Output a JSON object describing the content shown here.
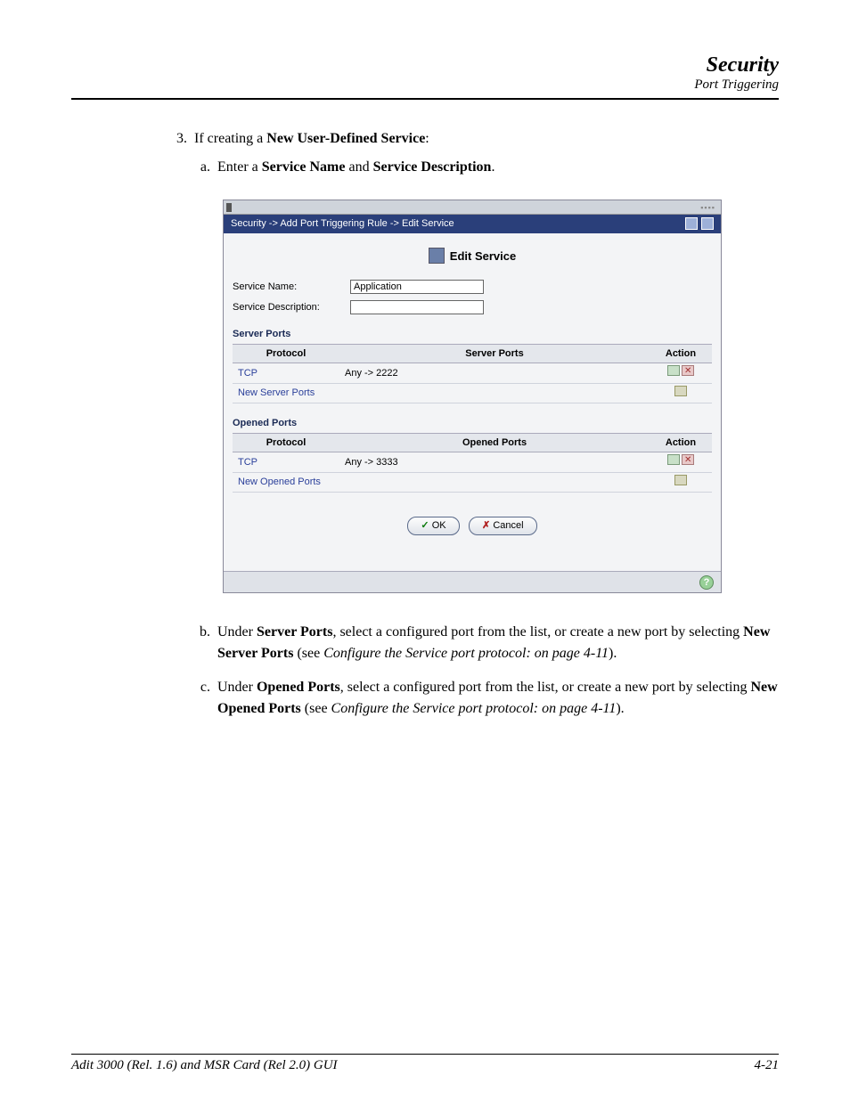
{
  "header": {
    "title": "Security",
    "subtitle": "Port Triggering"
  },
  "step3": {
    "num": "3.",
    "pre": "If creating a ",
    "bold": "New User-Defined Service",
    "post": ":"
  },
  "stepA": {
    "let": "a.",
    "pre": "Enter a ",
    "b1": "Service Name",
    "mid": " and ",
    "b2": "Service Description",
    "post": "."
  },
  "screenshot": {
    "breadcrumb": "Security -> Add Port Triggering Rule -> Edit Service",
    "panelTitle": "Edit Service",
    "serviceNameLabel": "Service Name:",
    "serviceNameValue": "Application",
    "serviceDescLabel": "Service Description:",
    "serviceDescValue": "",
    "serverPortsHeading": "Server Ports",
    "openedPortsHeading": "Opened Ports",
    "cols": {
      "protocol": "Protocol",
      "serverPorts": "Server Ports",
      "openedPorts": "Opened Ports",
      "action": "Action"
    },
    "serverRows": [
      {
        "protocol": "TCP",
        "ports": "Any -> 2222",
        "link": false
      },
      {
        "protocol": "New Server Ports",
        "ports": "",
        "link": true
      }
    ],
    "openedRows": [
      {
        "protocol": "TCP",
        "ports": "Any -> 3333",
        "link": false
      },
      {
        "protocol": "New Opened Ports",
        "ports": "",
        "link": true
      }
    ],
    "okLabel": "OK",
    "cancelLabel": "Cancel",
    "helpGlyph": "?"
  },
  "stepB": {
    "let": "b.",
    "pre": "Under ",
    "b1": "Server Ports",
    "mid1": ", select a configured port from the list, or create a new port by selecting ",
    "b2": "New Server Ports",
    "mid2": " (see ",
    "ital": "Configure the Service port protocol: on page  4-11",
    "post": ")."
  },
  "stepC": {
    "let": "c.",
    "pre": "Under ",
    "b1": "Opened Ports",
    "mid1": ", select a configured port from the list, or create a new port by selecting ",
    "b2": "New Opened Ports",
    "mid2": " (see ",
    "ital": "Configure the Service port protocol: on page  4-11",
    "post": ")."
  },
  "footer": {
    "left": "Adit 3000 (Rel. 1.6) and MSR Card (Rel 2.0) GUI",
    "right": "4-21"
  }
}
